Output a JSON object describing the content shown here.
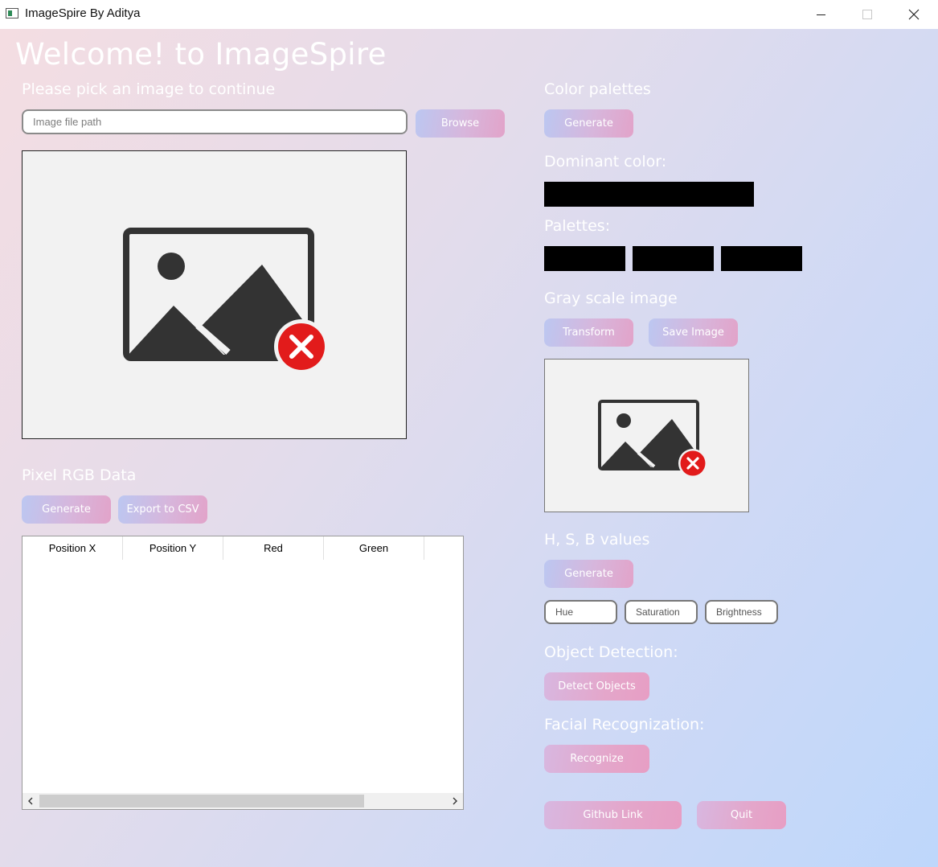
{
  "window": {
    "title": "ImageSpire By Aditya"
  },
  "app": {
    "welcome": "Welcome! to ImageSpire",
    "pick_prompt": "Please pick an image to continue",
    "path_placeholder": "Image file path",
    "browse_label": "Browse"
  },
  "palettes": {
    "heading": "Color palettes",
    "generate_label": "Generate",
    "dominant_heading": "Dominant color:",
    "dominant_color": "#000000",
    "palettes_heading": "Palettes:",
    "swatch_colors": [
      "#000000",
      "#000000",
      "#000000"
    ]
  },
  "grayscale": {
    "heading": "Gray scale image",
    "transform_label": "Transform",
    "save_label": "Save Image"
  },
  "pixel": {
    "heading": "Pixel RGB Data",
    "generate_label": "Generate",
    "export_label": "Export to CSV",
    "columns": [
      "Position X",
      "Position Y",
      "Red",
      "Green"
    ]
  },
  "hsb": {
    "heading": "H, S, B values",
    "generate_label": "Generate",
    "hue_placeholder": "Hue",
    "saturation_placeholder": "Saturation",
    "brightness_placeholder": "Brightness"
  },
  "objects": {
    "heading": "Object Detection:",
    "detect_label": "Detect Objects"
  },
  "faces": {
    "heading": "Facial Recognization:",
    "recognize_label": "Recognize"
  },
  "footer": {
    "github_label": "Github Link",
    "quit_label": "Quit"
  },
  "icons": {
    "placeholder_image": "broken-image-icon",
    "error_badge": "error-x-icon"
  }
}
